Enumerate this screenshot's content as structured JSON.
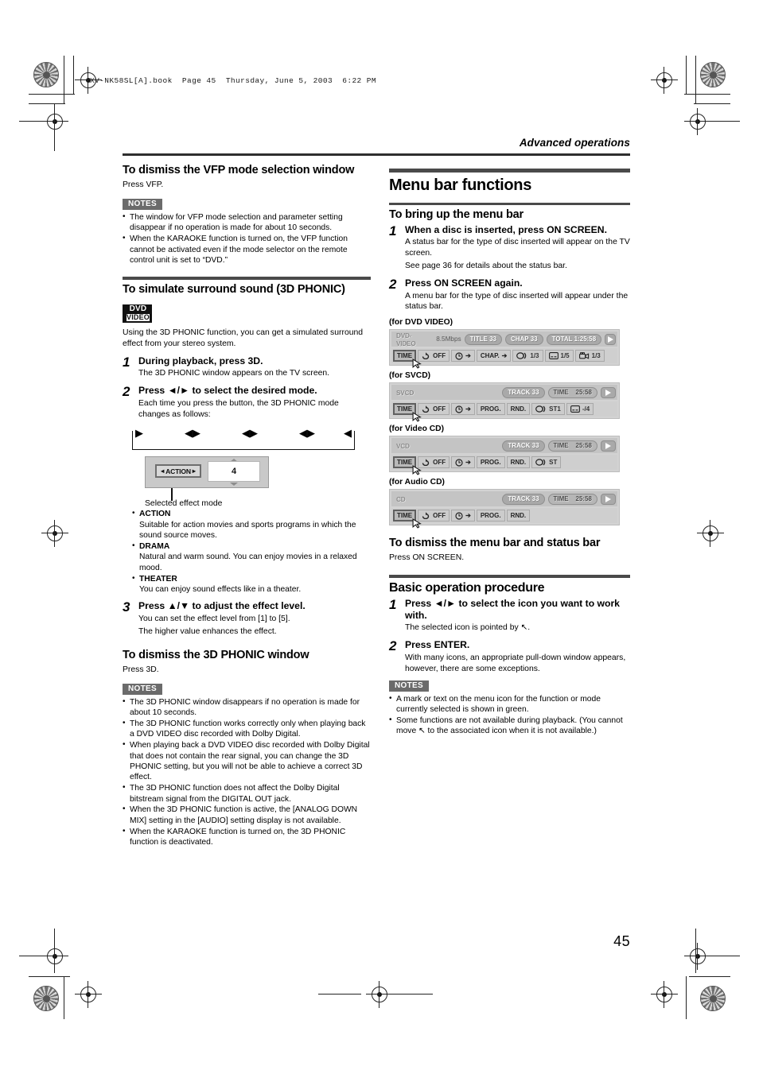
{
  "file_header": "XV-NK58SL[A].book  Page 45  Thursday, June 5, 2003  6:22 PM",
  "running_head": "Advanced operations",
  "page_number": "45",
  "left_column": {
    "s1_heading": "To dismiss the VFP mode selection window",
    "s1_body": "Press VFP.",
    "s1_notes_label": "NOTES",
    "s1_notes": [
      "The window for VFP mode selection and parameter setting disappear if no operation is made for about 10 seconds.",
      "When the KARAOKE function is turned on, the VFP function cannot be activated even if the mode selector on the remote control unit is set to “DVD.”"
    ],
    "s2_heading": "To simulate surround sound (3D PHONIC)",
    "s2_logo_line1": "DVD",
    "s2_logo_line2": "VIDEO",
    "s2_intro": "Using the 3D PHONIC function, you can get a simulated surround effect from your stereo system.",
    "s2_steps": [
      {
        "num": "1",
        "title": "During playback, press 3D.",
        "desc": "The 3D PHONIC window appears on the TV screen."
      },
      {
        "num": "2",
        "title": "Press ◄/►  to select the desired mode.",
        "desc": "Each time you press the button, the 3D PHONIC mode changes as follows:"
      }
    ],
    "cycle": {
      "labels": [
        "",
        "",
        "",
        ""
      ],
      "arrows": [
        "►",
        "◄►",
        "◄►",
        "◄►",
        "◄"
      ]
    },
    "panel": {
      "mode_label": "ACTION",
      "level_value": "4",
      "caption": "Selected effect mode"
    },
    "effect_modes": [
      {
        "name": "ACTION",
        "desc": "Suitable for action movies and sports programs in which the sound source moves."
      },
      {
        "name": "DRAMA",
        "desc": "Natural and warm sound. You can enjoy movies in a relaxed mood."
      },
      {
        "name": "THEATER",
        "desc": "You can enjoy sound effects like in a theater."
      }
    ],
    "s2_step3": {
      "num": "3",
      "title": "Press ▲/▼ to adjust the effect level.",
      "desc_line1": "You can set the effect level from [1] to [5].",
      "desc_line2": "The higher value enhances the effect."
    },
    "s3_heading": "To dismiss the 3D PHONIC window",
    "s3_body": "Press 3D.",
    "s3_notes_label": "NOTES",
    "s3_notes": [
      "The 3D PHONIC window disappears if no operation is made for about 10 seconds.",
      "The 3D PHONIC function works correctly only when playing back a DVD VIDEO disc recorded with Dolby Digital.",
      "When playing back a DVD VIDEO disc recorded with Dolby Digital that does not contain the rear signal, you can change the 3D PHONIC setting, but you will not be able to achieve a correct 3D effect.",
      "The 3D PHONIC function does not affect the Dolby Digital bitstream signal from the DIGITAL OUT jack.",
      "When the 3D PHONIC function is active, the [ANALOG DOWN MIX] setting in the [AUDIO] setting display is not available.",
      "When the KARAOKE function is turned on, the 3D PHONIC function is deactivated."
    ]
  },
  "right_column": {
    "title": "Menu bar functions",
    "s1_heading": "To bring up the menu bar",
    "s1_steps": [
      {
        "num": "1",
        "title": "When a disc is inserted, press ON SCREEN.",
        "desc_line1": "A status bar for the type of disc inserted will appear on the TV screen.",
        "desc_line2": "See page 36 for details about the status bar."
      },
      {
        "num": "2",
        "title": "Press ON SCREEN again.",
        "desc_line1": "A menu bar for the type of disc inserted will appear under the status bar.",
        "desc_line2": ""
      }
    ],
    "osd": [
      {
        "caption": "(for DVD VIDEO)",
        "disc_type": "DVD-VIDEO",
        "bitrate": "8.5Mbps",
        "chips": [
          "TITLE 33",
          "CHAP 33",
          "TOTAL 1:25:58"
        ],
        "buttons": [
          {
            "label": "TIME",
            "selected": true
          },
          {
            "icon": "repeat-icon",
            "label": "OFF"
          },
          {
            "icon": "clock-icon",
            "label": "➔"
          },
          {
            "label": "CHAP.",
            "icon2": "➔"
          },
          {
            "icon": "audio-icon",
            "label": "1/3"
          },
          {
            "icon": "subtitle-icon",
            "label": "1/5"
          },
          {
            "icon": "angle-icon",
            "label": "1/3"
          }
        ]
      },
      {
        "caption": "(for SVCD)",
        "disc_type": "SVCD",
        "bitrate": "",
        "chips": [
          "TRACK 33",
          "TIME    25:58"
        ],
        "buttons": [
          {
            "label": "TIME",
            "selected": true
          },
          {
            "icon": "repeat-icon",
            "label": "OFF"
          },
          {
            "icon": "clock-icon",
            "label": "➔"
          },
          {
            "label": "PROG."
          },
          {
            "label": "RND."
          },
          {
            "icon": "audio-icon",
            "label": "ST1"
          },
          {
            "icon": "subtitle-icon",
            "label": "-/4"
          }
        ]
      },
      {
        "caption": "(for Video CD)",
        "disc_type": "VCD",
        "bitrate": "",
        "chips": [
          "TRACK 33",
          "TIME    25:58"
        ],
        "buttons": [
          {
            "label": "TIME",
            "selected": true
          },
          {
            "icon": "repeat-icon",
            "label": "OFF"
          },
          {
            "icon": "clock-icon",
            "label": "➔"
          },
          {
            "label": "PROG."
          },
          {
            "label": "RND."
          },
          {
            "icon": "audio-icon",
            "label": "ST"
          }
        ]
      },
      {
        "caption": "(for Audio CD)",
        "disc_type": "CD",
        "bitrate": "",
        "chips": [
          "TRACK 33",
          "TIME    25:58"
        ],
        "buttons": [
          {
            "label": "TIME",
            "selected": true
          },
          {
            "icon": "repeat-icon",
            "label": "OFF"
          },
          {
            "icon": "clock-icon",
            "label": "➔"
          },
          {
            "label": "PROG."
          },
          {
            "label": "RND."
          }
        ]
      }
    ],
    "s2_heading": "To dismiss the menu bar and status bar",
    "s2_body": "Press ON SCREEN.",
    "s3_title": "Basic operation procedure",
    "s3_steps": [
      {
        "num": "1",
        "title": "Press ◄/► to select the icon you want to work with.",
        "desc": "The selected icon is pointed by ↖."
      },
      {
        "num": "2",
        "title": "Press ENTER.",
        "desc": "With many icons, an appropriate pull-down window appears, however, there are some exceptions."
      }
    ],
    "notes_label": "NOTES",
    "notes": [
      "A mark or text on the menu icon for the function or mode currently selected is shown in green.",
      "Some functions are not available during playback. (You cannot move ↖ to the associated icon when it is not available.)"
    ]
  }
}
